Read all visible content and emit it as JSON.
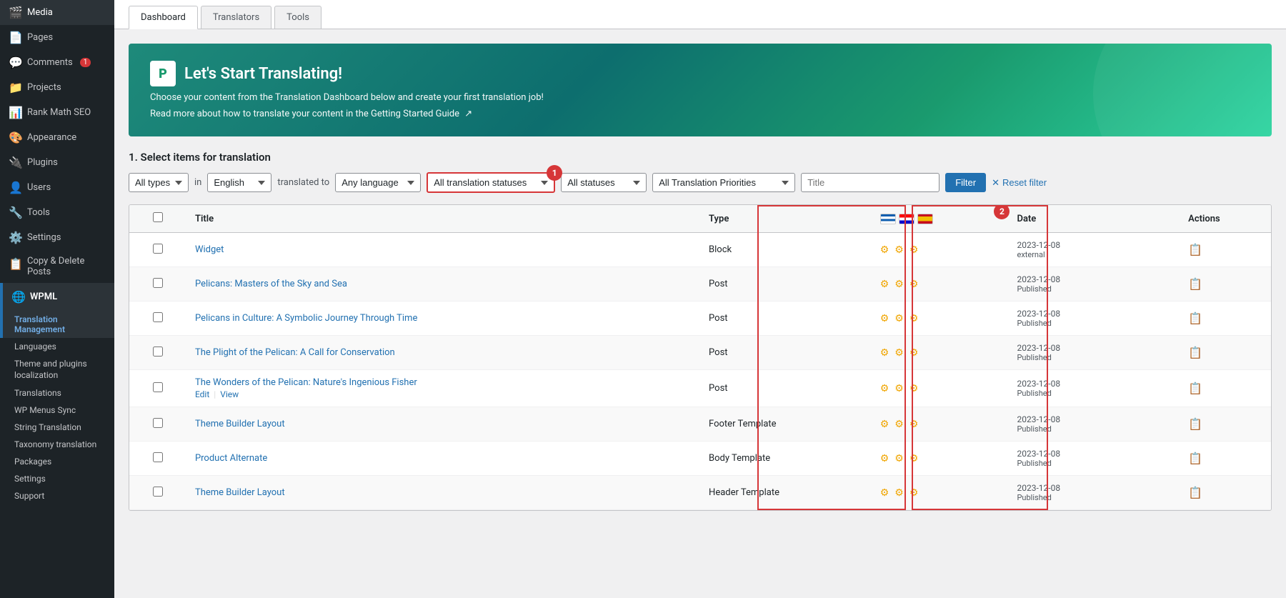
{
  "sidebar": {
    "items": [
      {
        "id": "media",
        "label": "Media",
        "icon": "🎬",
        "badge": null
      },
      {
        "id": "pages",
        "label": "Pages",
        "icon": "📄",
        "badge": null
      },
      {
        "id": "comments",
        "label": "Comments",
        "icon": "💬",
        "badge": "1"
      },
      {
        "id": "projects",
        "label": "Projects",
        "icon": "📁",
        "badge": null
      },
      {
        "id": "rank-math-seo",
        "label": "Rank Math SEO",
        "icon": "📊",
        "badge": null
      },
      {
        "id": "appearance",
        "label": "Appearance",
        "icon": "🎨",
        "badge": null
      },
      {
        "id": "plugins",
        "label": "Plugins",
        "icon": "🔌",
        "badge": null
      },
      {
        "id": "users",
        "label": "Users",
        "icon": "👤",
        "badge": null
      },
      {
        "id": "tools",
        "label": "Tools",
        "icon": "🔧",
        "badge": null
      },
      {
        "id": "settings",
        "label": "Settings",
        "icon": "⚙️",
        "badge": null
      },
      {
        "id": "copy-delete",
        "label": "Copy & Delete Posts",
        "icon": "📋",
        "badge": null
      }
    ],
    "wpml": {
      "label": "WPML",
      "sub_items": [
        {
          "id": "translation-management",
          "label": "Translation Management",
          "active": true
        },
        {
          "id": "languages",
          "label": "Languages"
        },
        {
          "id": "theme-plugins",
          "label": "Theme and plugins localization"
        },
        {
          "id": "translations",
          "label": "Translations"
        },
        {
          "id": "wp-menus-sync",
          "label": "WP Menus Sync"
        },
        {
          "id": "string-translation",
          "label": "String Translation"
        },
        {
          "id": "taxonomy-translation",
          "label": "Taxonomy translation"
        },
        {
          "id": "packages",
          "label": "Packages"
        },
        {
          "id": "settings-wpml",
          "label": "Settings"
        },
        {
          "id": "support",
          "label": "Support"
        }
      ]
    }
  },
  "tabs": [
    {
      "id": "dashboard",
      "label": "Dashboard",
      "active": true
    },
    {
      "id": "translators",
      "label": "Translators",
      "active": false
    },
    {
      "id": "tools",
      "label": "Tools",
      "active": false
    }
  ],
  "banner": {
    "icon": "P",
    "title": "Let's Start Translating!",
    "description": "Choose your content from the Translation Dashboard below and create your first translation job!",
    "link_text": "Read more about how to translate your content in the Getting Started Guide",
    "link_icon": "↗"
  },
  "section": {
    "title": "1. Select items for translation"
  },
  "filters": {
    "all_types": "All types",
    "in_label": "in",
    "english": "English",
    "translated_to": "translated to",
    "any_language": "Any language",
    "all_translation_statuses": "All translation statuses",
    "all_statuses": "All statuses",
    "all_translation_priorities": "All Translation Priorities",
    "title_placeholder": "Title",
    "filter_btn": "Filter",
    "reset_btn": "Reset filter"
  },
  "table": {
    "headers": {
      "title": "Title",
      "type": "Type",
      "date": "Date",
      "actions": "Actions"
    },
    "rows": [
      {
        "id": 1,
        "title": "Widget",
        "type": "Block",
        "date": "2023-12-08",
        "date_status": "external",
        "has_edit": false,
        "has_view": false
      },
      {
        "id": 2,
        "title": "Pelicans: Masters of the Sky and Sea",
        "type": "Post",
        "date": "2023-12-08",
        "date_status": "Published",
        "has_edit": false,
        "has_view": false
      },
      {
        "id": 3,
        "title": "Pelicans in Culture: A Symbolic Journey Through Time",
        "type": "Post",
        "date": "2023-12-08",
        "date_status": "Published",
        "has_edit": false,
        "has_view": false
      },
      {
        "id": 4,
        "title": "The Plight of the Pelican: A Call for Conservation",
        "type": "Post",
        "date": "2023-12-08",
        "date_status": "Published",
        "has_edit": false,
        "has_view": false
      },
      {
        "id": 5,
        "title": "The Wonders of the Pelican: Nature's Ingenious Fisher",
        "type": "Post",
        "date": "2023-12-08",
        "date_status": "Published",
        "has_edit": true,
        "has_view": true
      },
      {
        "id": 6,
        "title": "Theme Builder Layout",
        "type": "Footer Template",
        "date": "2023-12-08",
        "date_status": "Published",
        "has_edit": false,
        "has_view": false
      },
      {
        "id": 7,
        "title": "Product Alternate",
        "type": "Body Template",
        "date": "2023-12-08",
        "date_status": "Published",
        "has_edit": false,
        "has_view": false
      },
      {
        "id": 8,
        "title": "Theme Builder Layout",
        "type": "Header Template",
        "date": "2023-12-08",
        "date_status": "Published",
        "has_edit": false,
        "has_view": false
      }
    ],
    "edit_label": "Edit",
    "view_label": "View"
  },
  "annotations": {
    "badge1_num": "1",
    "badge2_num": "2"
  }
}
